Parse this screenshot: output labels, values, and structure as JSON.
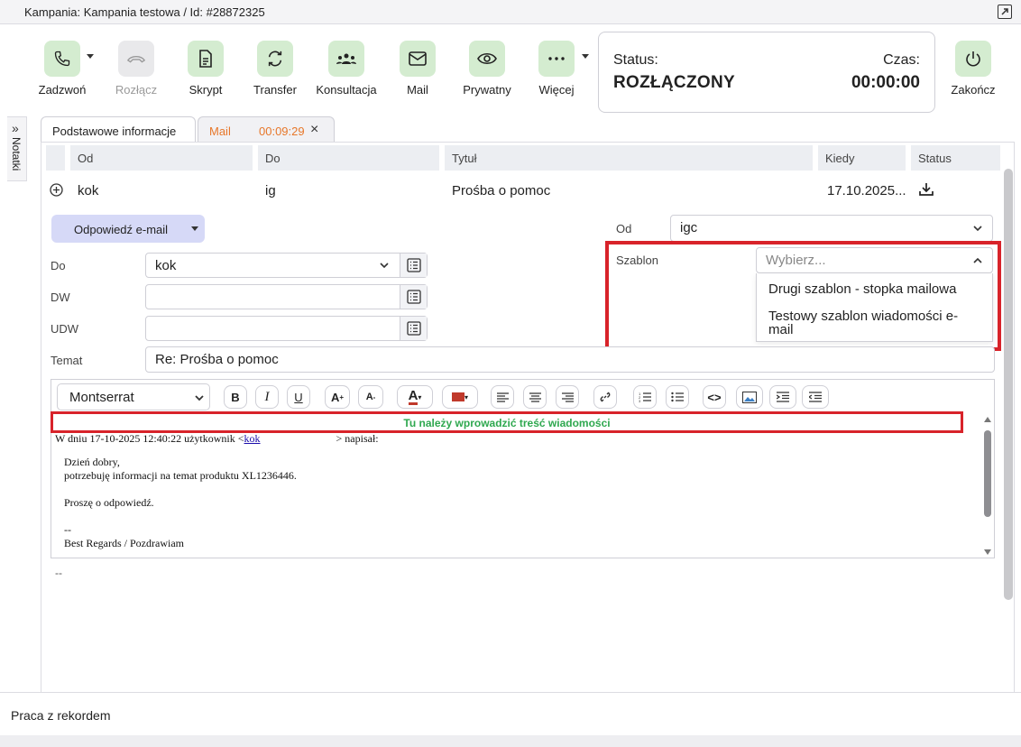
{
  "window": {
    "title": "Kampania: Kampania testowa / Id: #28872325"
  },
  "toolbar": {
    "buttons": [
      {
        "label": "Zadzwoń",
        "icon": "phone-icon"
      },
      {
        "label": "Rozłącz",
        "icon": "hangup-icon"
      },
      {
        "label": "Skrypt",
        "icon": "document-icon"
      },
      {
        "label": "Transfer",
        "icon": "transfer-icon"
      },
      {
        "label": "Konsultacja",
        "icon": "group-icon"
      },
      {
        "label": "Mail",
        "icon": "mail-icon"
      },
      {
        "label": "Prywatny",
        "icon": "eye-icon"
      },
      {
        "label": "Więcej",
        "icon": "more-icon"
      },
      {
        "label": "Zakończ",
        "icon": "power-icon"
      }
    ]
  },
  "status": {
    "status_label": "Status:",
    "status_value": "ROZŁĄCZONY",
    "time_label": "Czas:",
    "time_value": "00:00:00"
  },
  "notes": {
    "label": "Notatki"
  },
  "tabs": {
    "basic": "Podstawowe informacje",
    "mail": "Mail",
    "mail_timer": "00:09:29"
  },
  "table": {
    "headers": {
      "from": "Od",
      "to": "Do",
      "title": "Tytuł",
      "when": "Kiedy",
      "status": "Status"
    },
    "row": {
      "from": "kok",
      "to": "ig",
      "title": "Prośba o pomoc",
      "when": "17.10.2025..."
    }
  },
  "reply": {
    "label": "Odpowiedź e-mail"
  },
  "form": {
    "from_label": "Od",
    "from_value": "igc",
    "template_label": "Szablon",
    "template_placeholder": "Wybierz...",
    "template_options": [
      "Drugi szablon - stopka mailowa",
      "Testowy szablon wiadomości e-mail"
    ],
    "to_label": "Do",
    "to_value": "kok",
    "cc_label": "DW",
    "bcc_label": "UDW",
    "subject_label": "Temat",
    "subject_value": "Re: Prośba o pomoc"
  },
  "editor": {
    "font": "Montserrat",
    "hint": "Tu należy wprowadzić treść wiadomości",
    "quote_header_a": "W dniu 17-10-2025 12:40:22 użytkownik <",
    "quote_link": "kok",
    "quote_header_b": "> napisał:",
    "body": [
      "Dzień dobry,",
      "potrzebuję informacji na temat produktu XL1236446.",
      "",
      "Proszę o odpowiedź.",
      "",
      "--",
      "Best Regards / Pozdrawiam"
    ],
    "signature": "--"
  },
  "footer": {
    "label": "Praca z rekordem"
  }
}
